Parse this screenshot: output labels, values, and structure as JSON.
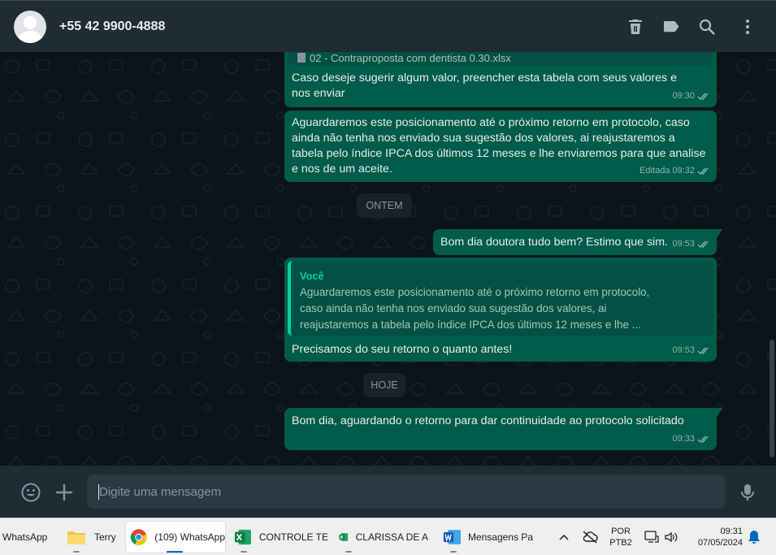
{
  "header": {
    "contact_name": "+55 42 9900-4888",
    "icons": [
      "avatar",
      "delete-icon",
      "label-icon",
      "search-icon",
      "menu-icon"
    ]
  },
  "messages": [
    {
      "attachment_name": "02 - Contraproposta com dentista 0.30.xlsx",
      "text": "Caso deseje sugerir algum valor, preencher esta tabela com seus valores e nos enviar",
      "time": "09:30"
    },
    {
      "text": "Aguardaremos este posicionamento até o próximo retorno em protocolo, caso ainda não tenha nos enviado sua sugestão dos valores, ai reajustaremos a tabela pelo índice IPCA dos últimos 12 meses e lhe enviaremos para que analise e nos de um aceite.",
      "edited_label": "Editada",
      "time": "09:32"
    },
    {
      "text": "Bom dia doutora tudo bem? Estimo que sim.",
      "time": "09:53"
    },
    {
      "quote_author": "Você",
      "quote_text": "Aguardaremos este posicionamento até o próximo retorno em protocolo, caso ainda não tenha nos enviado sua sugestão dos valores, ai reajustaremos a tabela pelo índice IPCA dos últimos 12 meses e lhe ...",
      "text": "Precisamos do seu retorno o quanto antes!",
      "time": "09:53"
    },
    {
      "text": "Bom dia, aguardando o retorno para dar continuidade ao protocolo solicitado",
      "time": "09:33"
    }
  ],
  "day_separators": [
    "ONTEM",
    "HOJE"
  ],
  "composer": {
    "placeholder": "Digite uma mensagem"
  },
  "taskbar": {
    "items": [
      {
        "label": "WhatsApp",
        "icon": "whatsapp-icon"
      },
      {
        "label": "Terry",
        "icon": "folder-icon"
      },
      {
        "label": "(109) WhatsApp",
        "icon": "chrome-icon"
      },
      {
        "label": "CONTROLE TE",
        "icon": "excel-icon"
      },
      {
        "label": "CLARISSA DE A",
        "icon": "excel-icon"
      },
      {
        "label": "Mensagens Pa",
        "icon": "word-icon"
      }
    ],
    "tray": {
      "language": "POR",
      "layout": "PTB2",
      "time": "09:31",
      "date": "07/05/2024"
    }
  },
  "colors": {
    "header_bg": "#202c33",
    "chat_bg": "#0b141a",
    "outgoing_bubble": "#005c4b",
    "accent": "#06cf9c"
  }
}
